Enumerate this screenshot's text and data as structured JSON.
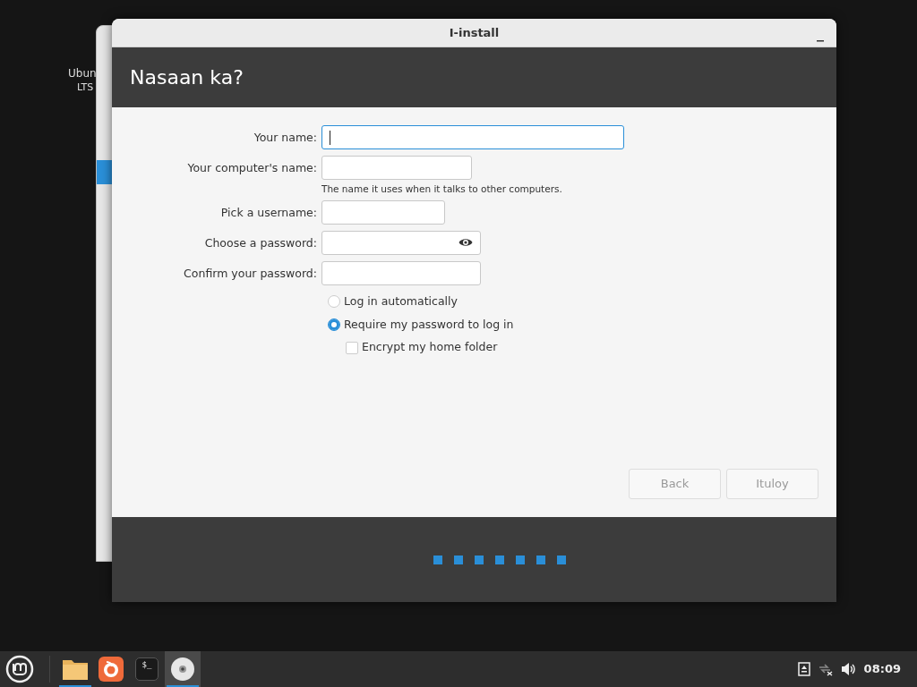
{
  "desktop": {
    "icon_label_lines": [
      "Ubun",
      "LTS"
    ]
  },
  "window": {
    "title": "I-install",
    "header": "Nasaan ka?",
    "fields": [
      {
        "kind": "text",
        "label": "Your name:",
        "focused": true
      },
      {
        "kind": "text",
        "label": "Your computer's name:",
        "focused": false,
        "hint": "The name it uses when it talks to other computers."
      },
      {
        "kind": "text",
        "label": "Pick a username:",
        "focused": false
      },
      {
        "kind": "password",
        "label": "Choose a password:",
        "focused": false
      },
      {
        "kind": "text",
        "label": "Confirm your password:",
        "focused": false
      }
    ],
    "login_options": [
      {
        "label": "Log in automatically",
        "selected": false
      },
      {
        "label": "Require my password to log in",
        "selected": true
      }
    ],
    "encrypt": {
      "label": "Encrypt my home folder",
      "checked": false
    },
    "buttons": [
      {
        "label": "Back",
        "disabled": true
      },
      {
        "label": "Ituloy",
        "disabled": true
      }
    ]
  },
  "taskbar": {
    "apps": [
      {
        "kind": "files",
        "running": true,
        "selected": false
      },
      {
        "kind": "firefox",
        "running": false,
        "selected": false
      },
      {
        "kind": "terminal",
        "label": "$_",
        "running": false,
        "selected": false
      },
      {
        "kind": "disc",
        "running": true,
        "selected": true
      }
    ],
    "clock": "08:09"
  }
}
